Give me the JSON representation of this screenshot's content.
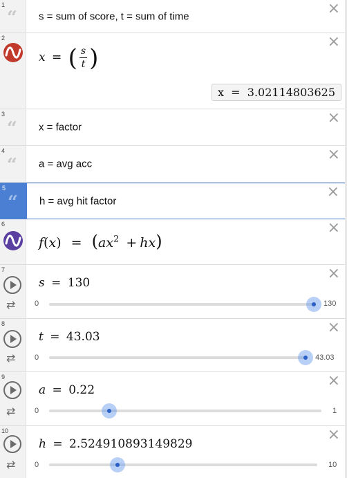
{
  "expressions": [
    {
      "num": "1",
      "type": "note",
      "text": "s = sum of score, t = sum of time"
    },
    {
      "num": "2",
      "type": "expr",
      "lhs": "x",
      "eq": "=",
      "frac_num": "s",
      "frac_den": "t",
      "eval": "x  =  3.02114803625"
    },
    {
      "num": "3",
      "type": "note",
      "text": "x = factor"
    },
    {
      "num": "4",
      "type": "note",
      "text": "a = avg acc"
    },
    {
      "num": "5",
      "type": "note",
      "text": "h = avg hit factor",
      "selected": true
    },
    {
      "num": "6",
      "type": "func",
      "f": "f",
      "arg": "x",
      "eq": "=",
      "a": "a",
      "xvar": "x",
      "exp": "2",
      "plus": "+",
      "h": "h"
    },
    {
      "num": "7",
      "type": "slider",
      "var": "s",
      "eq": "=",
      "value": "130",
      "min": "0",
      "max": "130",
      "frac": 1.0
    },
    {
      "num": "8",
      "type": "slider",
      "var": "t",
      "eq": "=",
      "value": "43.03",
      "min": "0",
      "max": "43.03",
      "frac": 1.0
    },
    {
      "num": "9",
      "type": "slider",
      "var": "a",
      "eq": "=",
      "value": "0.22",
      "min": "0",
      "max": "1",
      "frac": 0.22
    },
    {
      "num": "10",
      "type": "slider",
      "var": "h",
      "eq": "=",
      "value": "2.524910893149829",
      "min": "0",
      "max": "10",
      "frac": 0.2525
    }
  ],
  "icons": {
    "close": "×",
    "quote": "“",
    "repeat": "⇄"
  },
  "colors": {
    "logo_red": "#c0392b",
    "logo_purple": "#5b3fa0",
    "slider_knob": "#2a5fc7",
    "selected": "#4a7fd4"
  }
}
